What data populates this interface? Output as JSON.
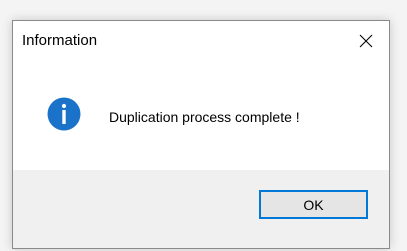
{
  "window": {
    "title": "Information",
    "close_icon": "close-icon"
  },
  "content": {
    "icon": "info-icon",
    "message": "Duplication process complete !"
  },
  "buttons": {
    "ok_label": "OK"
  },
  "colors": {
    "accent": "#0078d7",
    "info_icon_fill": "#1a73c9",
    "footer_bg": "#f0f0f0"
  }
}
